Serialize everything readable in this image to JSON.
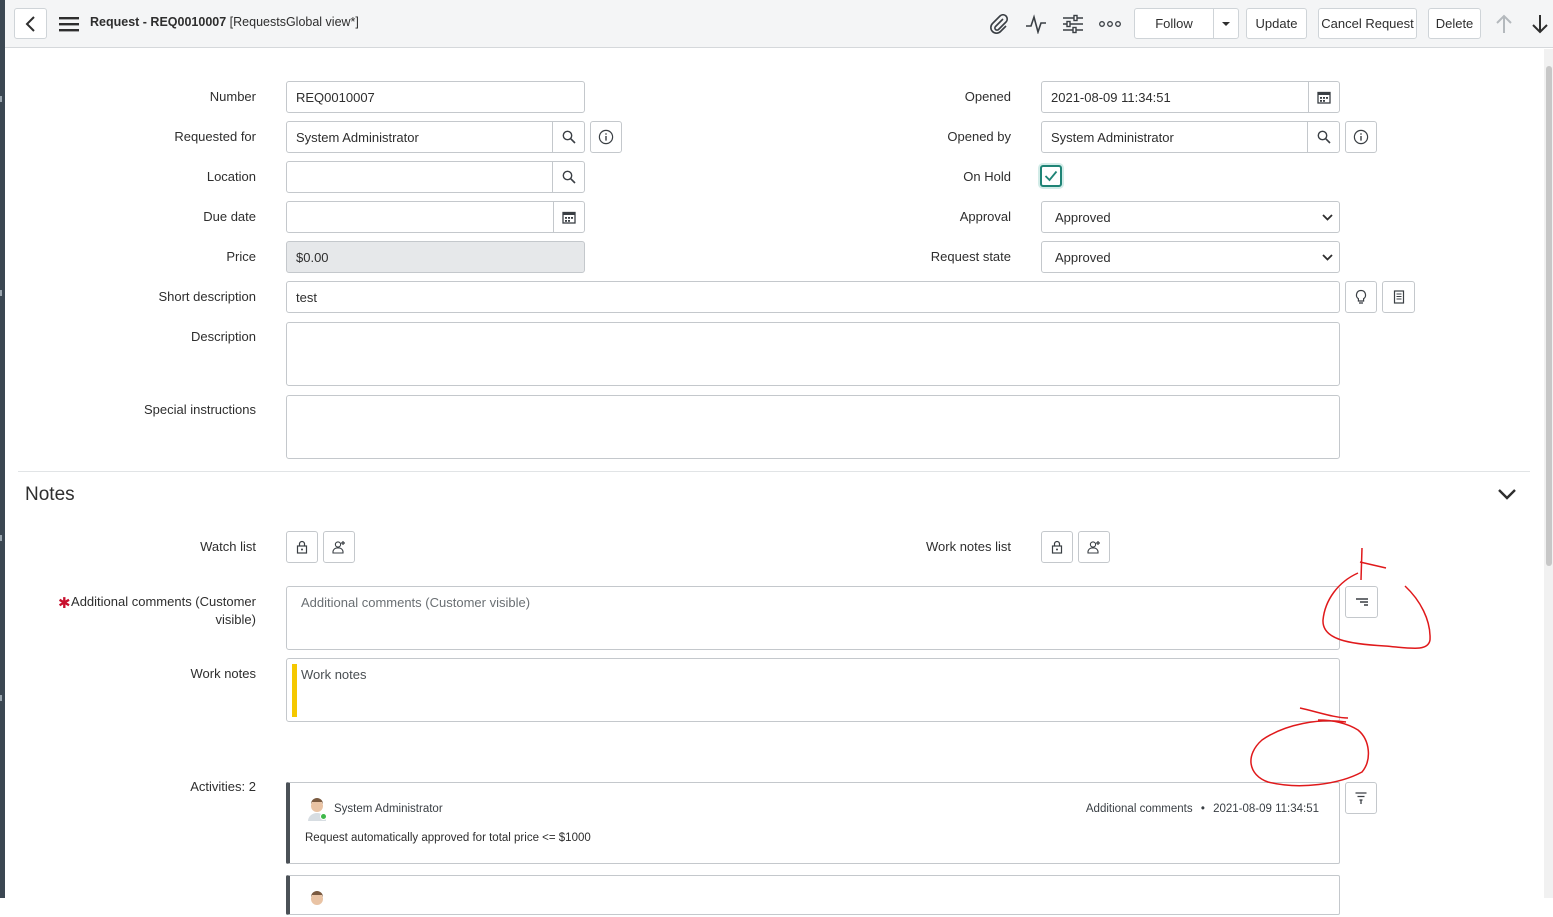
{
  "header": {
    "title_bold": "Request - REQ0010007",
    "title_rest": " [RequestsGlobal view*]",
    "buttons": {
      "follow": "Follow",
      "update": "Update",
      "cancel_request": "Cancel Request",
      "delete": "Delete"
    }
  },
  "form": {
    "number": {
      "label": "Number",
      "value": "REQ0010007"
    },
    "requested_for": {
      "label": "Requested for",
      "value": "System Administrator"
    },
    "location": {
      "label": "Location",
      "value": ""
    },
    "due_date": {
      "label": "Due date",
      "value": ""
    },
    "price": {
      "label": "Price",
      "value": "$0.00"
    },
    "opened": {
      "label": "Opened",
      "value": "2021-08-09 11:34:51"
    },
    "opened_by": {
      "label": "Opened by",
      "value": "System Administrator"
    },
    "on_hold": {
      "label": "On Hold",
      "checked": true
    },
    "approval": {
      "label": "Approval",
      "value": "Approved"
    },
    "request_state": {
      "label": "Request state",
      "value": "Approved"
    },
    "short_description": {
      "label": "Short description",
      "value": "test"
    },
    "description": {
      "label": "Description",
      "value": ""
    },
    "special_instructions": {
      "label": "Special instructions",
      "value": ""
    }
  },
  "notes": {
    "title": "Notes",
    "watch_list_label": "Watch list",
    "work_notes_list_label": "Work notes list",
    "additional_comments": {
      "label_line1": "Additional comments (Customer",
      "label_line2": "visible)",
      "required_mark": "✱",
      "placeholder": "Additional comments (Customer visible)"
    },
    "work_notes": {
      "label": "Work notes",
      "placeholder": "Work notes"
    },
    "activities_label": "Activities: 2"
  },
  "activities": [
    {
      "user": "System Administrator",
      "type": "Additional comments",
      "separator": "•",
      "timestamp": "2021-08-09 11:34:51",
      "text": "Request automatically approved for total price <= $1000"
    }
  ],
  "colors": {
    "accent_teal": "#1f8476",
    "annotation_red": "#e0191b",
    "work_notes_bar": "#f5c800",
    "required": "#c8102e"
  },
  "icons": [
    "back-arrow-icon",
    "hamburger-menu-icon",
    "paperclip-icon",
    "activity-pulse-icon",
    "sliders-icon",
    "more-dots-icon",
    "caret-down-icon",
    "arrow-up-icon",
    "arrow-down-icon",
    "search-icon",
    "info-icon",
    "calendar-icon",
    "check-icon",
    "lightbulb-icon",
    "document-icon",
    "lock-icon",
    "add-user-icon",
    "chevron-down-icon",
    "post-icon",
    "filter-icon",
    "avatar"
  ]
}
